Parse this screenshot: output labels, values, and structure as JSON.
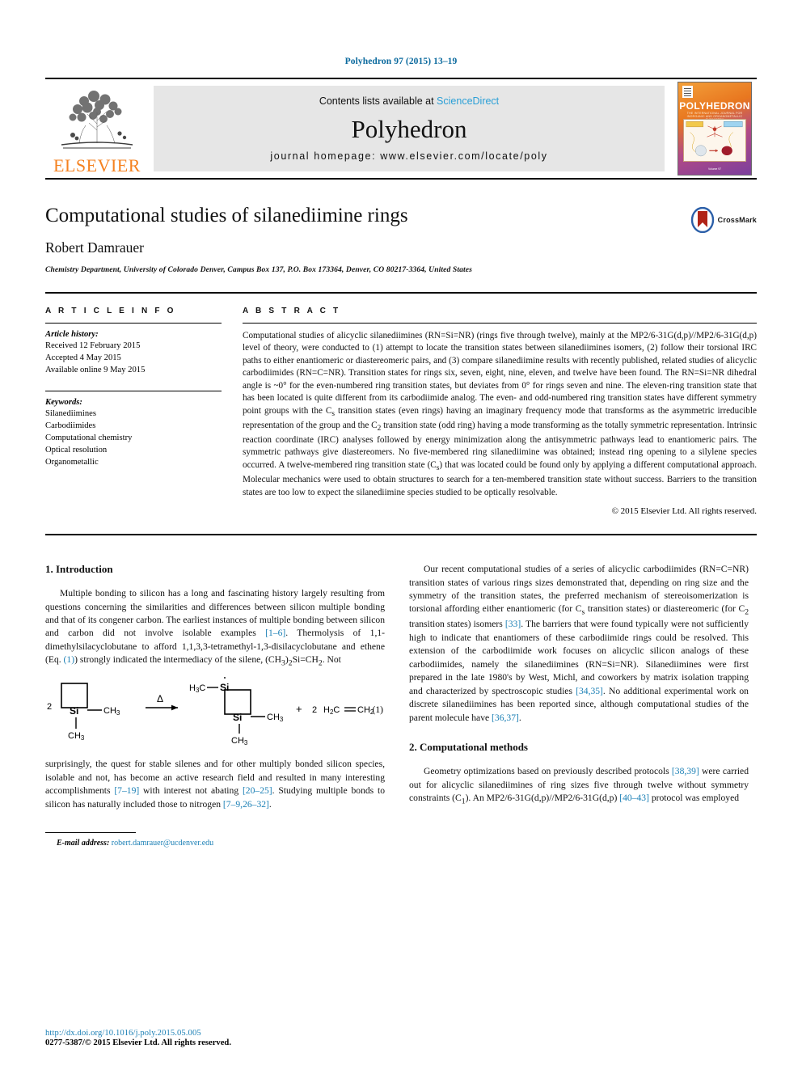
{
  "running_head": "Polyhedron 97 (2015) 13–19",
  "masthead": {
    "publisher": "ELSEVIER",
    "contents_prefix": "Contents lists available at ",
    "contents_link": "ScienceDirect",
    "journal_title": "Polyhedron",
    "homepage": "journal homepage: www.elsevier.com/locate/poly",
    "cover": {
      "title": "POLYHEDRON",
      "subtitle": "THE INTERNATIONAL JOURNAL FOR INORGANIC AND ORGANOMETALLIC CHEMISTRY",
      "footer": "Volume 97"
    }
  },
  "article": {
    "title": "Computational studies of silanediimine rings",
    "author": "Robert Damrauer",
    "affiliation": "Chemistry Department, University of Colorado Denver, Campus Box 137, P.O. Box 173364, Denver, CO 80217-3364, United States",
    "crossmark_label": "CrossMark"
  },
  "info": {
    "heading": "A R T I C L E   I N F O",
    "history_label": "Article history:",
    "history": [
      "Received 12 February 2015",
      "Accepted 4 May 2015",
      "Available online 9 May 2015"
    ],
    "keywords_label": "Keywords:",
    "keywords": [
      "Silanediimines",
      "Carbodiimides",
      "Computational chemistry",
      "Optical resolution",
      "Organometallic"
    ]
  },
  "abstract": {
    "heading": "A B S T R A C T",
    "text": "Computational studies of alicyclic silanediimines (RN=Si=NR) (rings five through twelve), mainly at the MP2/6-31G(d,p)//MP2/6-31G(d,p) level of theory, were conducted to (1) attempt to locate the transition states between silanediimines isomers, (2) follow their torsional IRC paths to either enantiomeric or diastereomeric pairs, and (3) compare silanediimine results with recently published, related studies of alicyclic carbodiimides (RN=C=NR). Transition states for rings six, seven, eight, nine, eleven, and twelve have been found. The RN=Si=NR dihedral angle is ~0° for the even-numbered ring transition states, but deviates from 0° for rings seven and nine. The eleven-ring transition state that has been located is quite different from its carbodiimide analog. The even- and odd-numbered ring transition states have different symmetry point groups with the Cs transition states (even rings) having an imaginary frequency mode that transforms as the asymmetric irreducible representation of the group and the C2 transition state (odd ring) having a mode transforming as the totally symmetric representation. Intrinsic reaction coordinate (IRC) analyses followed by energy minimization along the antisymmetric pathways lead to enantiomeric pairs. The symmetric pathways give diastereomers. No five-membered ring silanediimine was obtained; instead ring opening to a silylene species occurred. A twelve-membered ring transition state (Cs) that was located could be found only by applying a different computational approach. Molecular mechanics were used to obtain structures to search for a ten-membered transition state without success. Barriers to the transition states are too low to expect the silanediimine species studied to be optically resolvable.",
    "copyright": "© 2015 Elsevier Ltd. All rights reserved."
  },
  "body": {
    "section1_heading": "1. Introduction",
    "section1_p1_a": "Multiple bonding to silicon has a long and fascinating history largely resulting from questions concerning the similarities and differences between silicon multiple bonding and that of its congener carbon. The earliest instances of multiple bonding between silicon and carbon did not involve isolable examples ",
    "ref_1_6": "[1–6]",
    "section1_p1_b": ". Thermolysis of 1,1-dimethylsilacyclobutane to afford 1,1,3,3-tetramethyl-1,3-disilacyclobutane and ethene (Eq. ",
    "eq_link": "(1)",
    "section1_p1_c": ") strongly indicated the intermediacy of the silene, (CH3)2Si=CH2. Not",
    "equation_number": "(1)",
    "scheme": {
      "stoich_left": "2",
      "delta": "Δ",
      "plus": "+",
      "stoich_right": "2",
      "ethene": "H2C=CH2",
      "label_ch3": "CH3",
      "label_h3c": "H3C",
      "label_si": "Si"
    },
    "section1_p2_a": "surprisingly, the quest for stable silenes and for other multiply bonded silicon species, isolable and not, has become an active research field and resulted in many interesting accomplishments ",
    "ref_7_19": "[7–19]",
    "section1_p2_b": " with interest not abating ",
    "ref_20_25": "[20–25]",
    "section1_p2_c": ". Studying multiple bonds to silicon has naturally included those to nitrogen ",
    "ref_7_9_26_32": "[7–9,26–32]",
    "section1_p2_d": ".",
    "right_p1_a": "Our recent computational studies of a series of alicyclic carbodiimides (RN=C=NR) transition states of various rings sizes demonstrated that, depending on ring size and the symmetry of the transition states, the preferred mechanism of stereoisomerization is torsional affording either enantiomeric (for Cs transition states) or diastereomeric (for C2 transition states) isomers ",
    "ref_33": "[33]",
    "right_p1_b": ". The barriers that were found typically were not sufficiently high to indicate that enantiomers of these carbodiimide rings could be resolved. This extension of the carbodiimide work focuses on alicyclic silicon analogs of these carbodiimides, namely the silanediimines (RN=Si=NR). Silanediimines were first prepared in the late 1980's by West, Michl, and coworkers by matrix isolation trapping and characterized by spectroscopic studies ",
    "ref_34_35": "[34,35]",
    "right_p1_c": ". No additional experimental work on discrete silanediimines has been reported since, although computational studies of the parent molecule have ",
    "ref_36_37": "[36,37]",
    "right_p1_d": ".",
    "section2_heading": "2. Computational methods",
    "right_p2_a": "Geometry optimizations based on previously described protocols ",
    "ref_38_39": "[38,39]",
    "right_p2_b": " were carried out for alicyclic silanediimines of ring sizes five through twelve without symmetry constraints (C1). An MP2/6-31G(d,p)//MP2/6-31G(d,p) ",
    "ref_40_43": "[40–43]",
    "right_p2_c": " protocol was employed"
  },
  "footnote": {
    "label": "E-mail address:",
    "email": "robert.damrauer@ucdenver.edu"
  },
  "footer": {
    "doi": "http://dx.doi.org/10.1016/j.poly.2015.05.005",
    "issn": "0277-5387/© 2015 Elsevier Ltd. All rights reserved."
  },
  "colors": {
    "link": "#1a7fb5",
    "elsevier_orange": "#f58220",
    "sciencedirect": "#2a9fd6"
  }
}
